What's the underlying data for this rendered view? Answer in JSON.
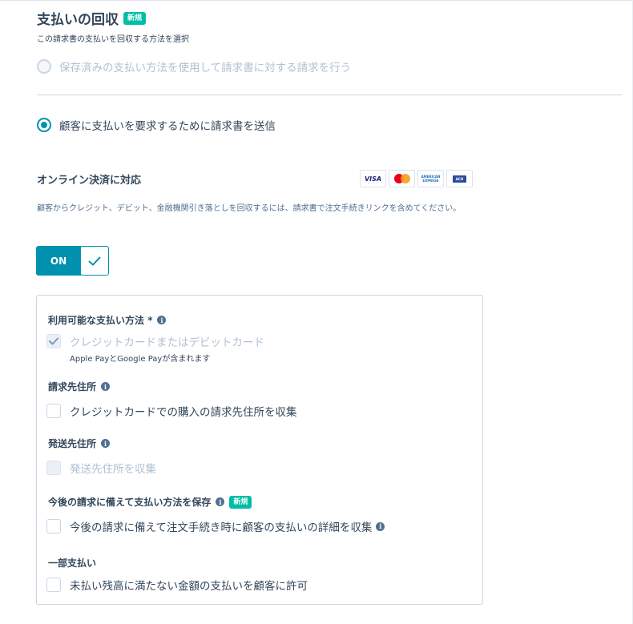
{
  "header": {
    "title": "支払いの回収",
    "new_badge": "新規",
    "subtitle": "この請求書の支払いを回収する方法を選択"
  },
  "payment_collection": {
    "options": [
      {
        "label": "保存済みの支払い方法を使用して請求書に対する請求を行う",
        "selected": false,
        "disabled": true
      },
      {
        "label": "顧客に支払いを要求するために請求書を送信",
        "selected": true,
        "disabled": false
      }
    ]
  },
  "online_payment": {
    "title": "オンライン決済に対応",
    "cards": [
      {
        "name": "VISA",
        "icon": "visa-logo"
      },
      {
        "name": "Mastercard",
        "icon": "mastercard-logo"
      },
      {
        "name": "AMERICAN EXPRESS",
        "icon": "amex-logo"
      },
      {
        "name": "ACH",
        "icon": "ach-logo"
      }
    ],
    "description": "顧客からクレジット、デビット、金融機関引き落としを回収するには、請求書で注文手続きリンクを含めてください。",
    "toggle_label": "ON",
    "toggle_on": true
  },
  "settings": {
    "payment_methods": {
      "label": "利用可能な支払い方法",
      "required_mark": "*",
      "option": "クレジットカードまたはデビットカード",
      "option_checked": true,
      "option_disabled": true,
      "note": "Apple PayとGoogle Payが含まれます"
    },
    "billing_address": {
      "label": "請求先住所",
      "option": "クレジットカードでの購入の請求先住所を収集",
      "option_checked": false
    },
    "shipping_address": {
      "label": "発送先住所",
      "option": "発送先住所を収集",
      "option_disabled": true
    },
    "save_method": {
      "label": "今後の請求に備えて支払い方法を保存",
      "badge": "新規",
      "option": "今後の請求に備えて注文手続き時に顧客の支払いの詳細を収集",
      "option_checked": false
    },
    "partial_payment": {
      "label": "一部支払い",
      "option": "未払い残高に満たない金額の支払いを顧客に許可",
      "option_checked": false
    }
  },
  "colors": {
    "accent": "#0091ae",
    "badge": "#00bda5",
    "text": "#33475b",
    "disabled_text": "#b0c1d4"
  }
}
